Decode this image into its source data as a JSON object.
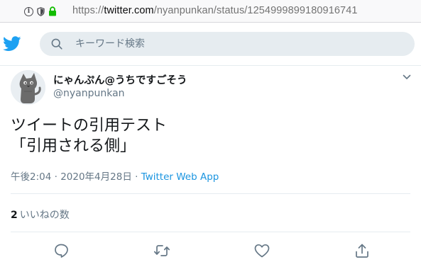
{
  "browser": {
    "url_prefix": "https://",
    "url_host": "twitter.com",
    "url_path": "/nyanpunkan/status/1254999899180916741"
  },
  "header": {
    "search_placeholder": "キーワード検索"
  },
  "tweet": {
    "display_name": "にゃんぷん@うちですごそう",
    "handle": "@nyanpunkan",
    "text": "ツイートの引用テスト\n「引用される側」",
    "time": "午後2:04",
    "separator": " · ",
    "date": "2020年4月28日",
    "source": "Twitter Web App",
    "likes_count": "2",
    "likes_label": "いいねの数"
  },
  "icons": [
    "info-icon",
    "shield-icon",
    "lock-icon",
    "twitter-bird-icon",
    "search-icon",
    "caret-down-icon",
    "reply-icon",
    "retweet-icon",
    "like-icon",
    "share-icon"
  ],
  "colors": {
    "brand": "#1da1f2",
    "link": "#1b95e0",
    "secure_lock": "#12bc00",
    "muted": "#657786"
  }
}
